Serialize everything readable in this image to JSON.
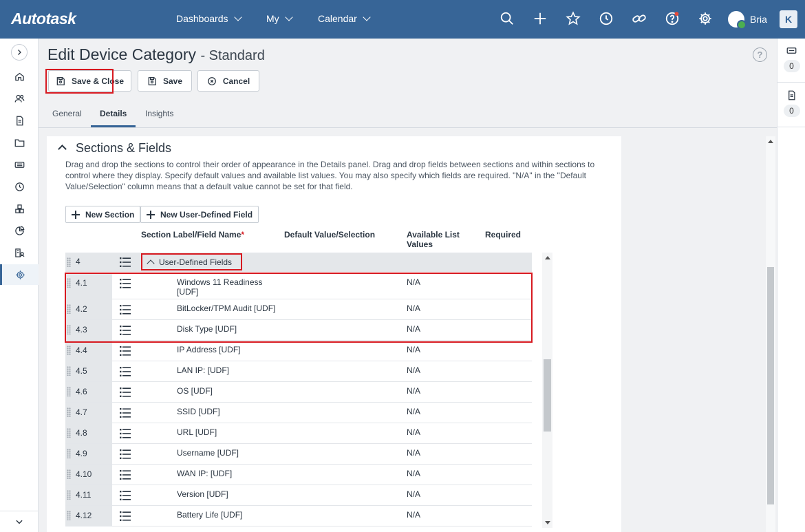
{
  "app": {
    "logo": "Autotask"
  },
  "nav": {
    "items": [
      {
        "label": "Dashboards"
      },
      {
        "label": "My"
      },
      {
        "label": "Calendar"
      }
    ]
  },
  "user": {
    "name": "Bria",
    "badge": "K"
  },
  "page": {
    "title": "Edit Device Category",
    "subtitle": "- Standard",
    "help": "?"
  },
  "toolbar": {
    "save_close_label": "Save & Close",
    "save_label": "Save",
    "cancel_label": "Cancel"
  },
  "tabs": [
    {
      "label": "General",
      "active": false
    },
    {
      "label": "Details",
      "active": true
    },
    {
      "label": "Insights",
      "active": false
    }
  ],
  "right_panel": {
    "tickets_count": "0",
    "notes_count": "0"
  },
  "section": {
    "title": "Sections & Fields",
    "description": "Drag and drop the sections to control their order of appearance in the Details panel. Drag and drop fields between sections and within sections to control where they display. Specify default values and available list values. You may also specify which fields are required. \"N/A\" in the \"Default Value/Selection\" column means that a default value cannot be set for that field.",
    "new_section_label": "New Section",
    "new_udf_label": "New User-Defined Field"
  },
  "columns": {
    "label": "Section Label/Field Name",
    "required_marker": "*",
    "default_value": "Default Value/Selection",
    "available_values": "Available List Values",
    "required": "Required"
  },
  "section_row": {
    "num": "4",
    "label": "User-Defined Fields"
  },
  "rows": [
    {
      "num": "4.1",
      "name": "Windows 11 Readiness [UDF]",
      "value": "N/A"
    },
    {
      "num": "4.2",
      "name": "BitLocker/TPM Audit [UDF]",
      "value": "N/A"
    },
    {
      "num": "4.3",
      "name": "Disk Type [UDF]",
      "value": "N/A"
    },
    {
      "num": "4.4",
      "name": "IP Address [UDF]",
      "value": "N/A"
    },
    {
      "num": "4.5",
      "name": "LAN IP: [UDF]",
      "value": "N/A"
    },
    {
      "num": "4.6",
      "name": "OS [UDF]",
      "value": "N/A"
    },
    {
      "num": "4.7",
      "name": "SSID [UDF]",
      "value": "N/A"
    },
    {
      "num": "4.8",
      "name": "URL [UDF]",
      "value": "N/A"
    },
    {
      "num": "4.9",
      "name": "Username [UDF]",
      "value": "N/A"
    },
    {
      "num": "4.10",
      "name": "WAN IP: [UDF]",
      "value": "N/A"
    },
    {
      "num": "4.11",
      "name": "Version [UDF]",
      "value": "N/A"
    },
    {
      "num": "4.12",
      "name": "Battery Life [UDF]",
      "value": "N/A"
    }
  ],
  "colors": {
    "topbar": "#376597",
    "highlight": "#d71920",
    "tab_active": "#376597"
  }
}
